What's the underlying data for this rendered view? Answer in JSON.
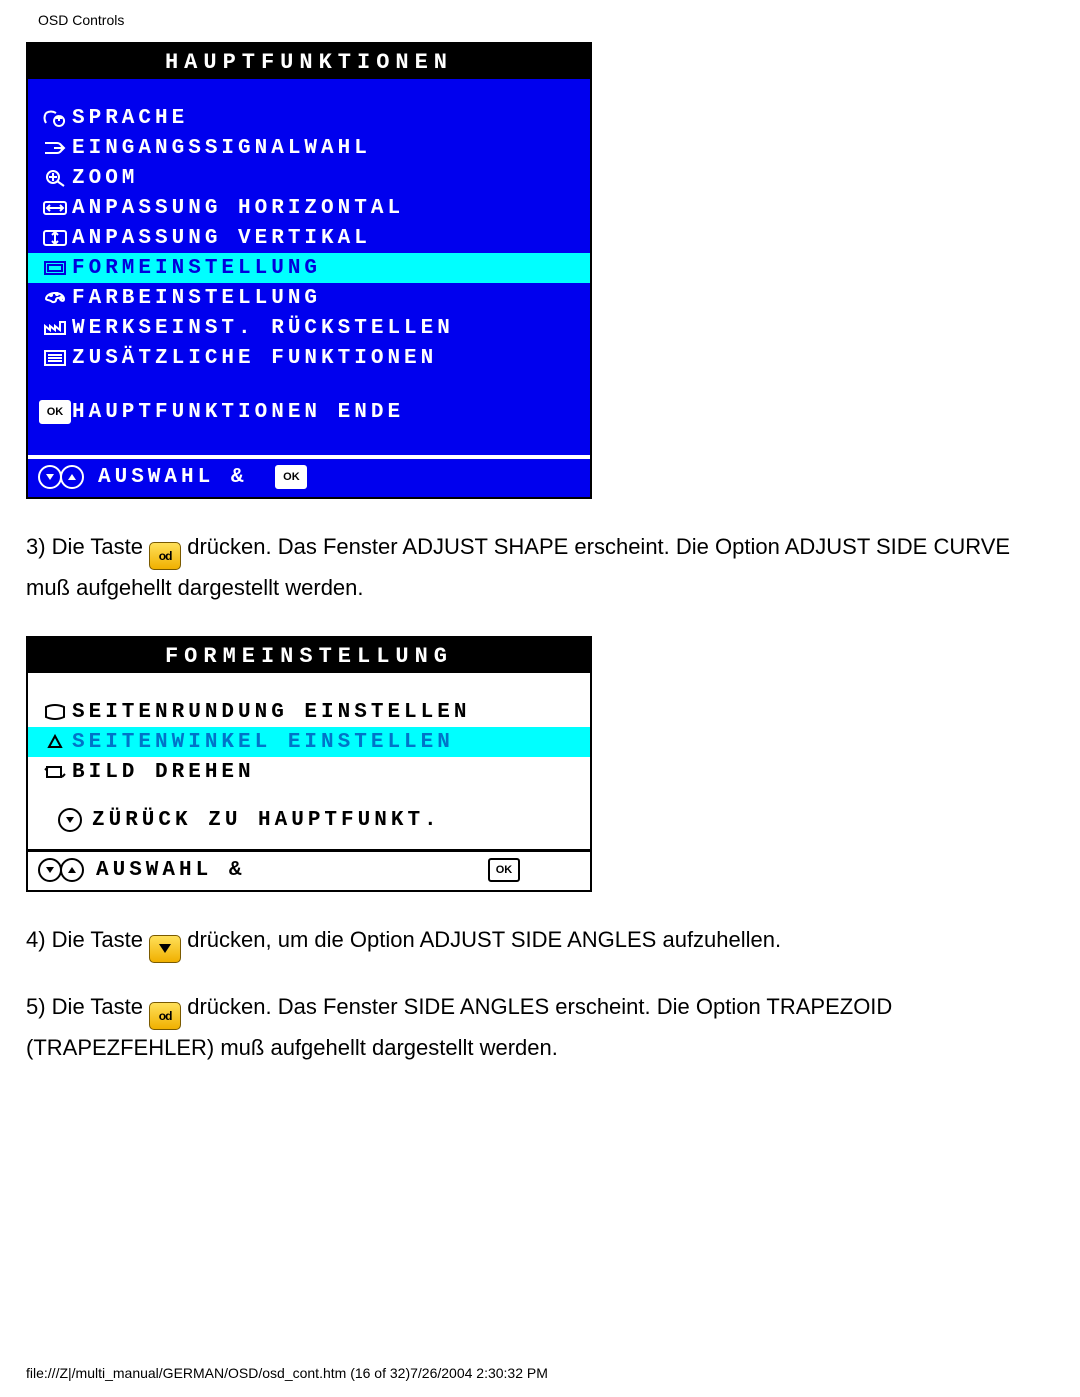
{
  "header": "OSD Controls",
  "osd1": {
    "title": "HAUPTFUNKTIONEN",
    "items": [
      "SPRACHE",
      "EINGANGSSIGNALWAHL",
      "ZOOM",
      "ANPASSUNG HORIZONTAL",
      "ANPASSUNG VERTIKAL",
      "FORMEINSTELLUNG",
      "FARBEINSTELLUNG",
      "WERKSEINST. RÜCKSTELLEN",
      "ZUSÄTZLICHE FUNKTIONEN"
    ],
    "exit": "HAUPTFUNKTIONEN ENDE",
    "footer": "AUSWAHL &"
  },
  "p3a": "3) Die Taste ",
  "p3b": " drücken. Das Fenster ADJUST SHAPE erscheint. Die Option ADJUST SIDE CURVE muß aufgehellt dargestellt werden.",
  "osd2": {
    "title": "FORMEINSTELLUNG",
    "items": [
      "SEITENRUNDUNG EINSTELLEN",
      "SEITENWINKEL EINSTELLEN",
      "BILD DREHEN"
    ],
    "back": "ZÜRÜCK ZU HAUPTFUNKT.",
    "footer": "AUSWAHL &"
  },
  "p4a": "4) Die Taste ",
  "p4b": " drücken, um die Option ADJUST SIDE ANGLES aufzuhellen.",
  "p5a": "5) Die Taste ",
  "p5b": " drücken. Das Fenster SIDE ANGLES erscheint. Die Option TRAPEZOID (TRAPEZFEHLER) muß aufgehellt dargestellt werden.",
  "footer": "file:///Z|/multi_manual/GERMAN/OSD/osd_cont.htm (16 of 32)7/26/2004 2:30:32 PM"
}
